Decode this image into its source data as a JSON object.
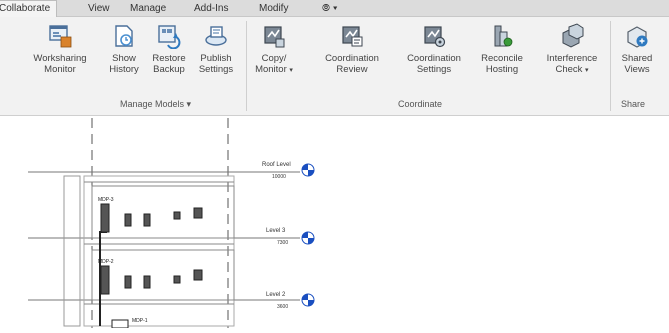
{
  "tabs": [
    "Collaborate",
    "View",
    "Manage",
    "Add-Ins",
    "Modify",
    "⦾ ▾"
  ],
  "ribbon": {
    "buttons": [
      {
        "line1": "Worksharing",
        "line2": "Monitor",
        "icon": "worksharing-monitor-icon"
      },
      {
        "line1": "Show",
        "line2": "History",
        "icon": "show-history-icon"
      },
      {
        "line1": "Restore",
        "line2": "Backup",
        "icon": "restore-backup-icon"
      },
      {
        "line1": "Publish",
        "line2": "Settings",
        "icon": "publish-settings-icon"
      },
      {
        "line1": "Copy/",
        "line2": "Monitor",
        "icon": "copy-monitor-icon"
      },
      {
        "line1": "Coordination",
        "line2": "Review",
        "icon": "coordination-review-icon"
      },
      {
        "line1": "Coordination",
        "line2": "Settings",
        "icon": "coordination-settings-icon"
      },
      {
        "line1": "Reconcile",
        "line2": "Hosting",
        "icon": "reconcile-hosting-icon"
      },
      {
        "line1": "Interference",
        "line2": "Check",
        "icon": "interference-check-icon"
      },
      {
        "line1": "Shared",
        "line2": "Views",
        "icon": "shared-views-icon"
      }
    ],
    "panels": {
      "manage_models": "Manage Models ▾",
      "coordinate": "Coordinate",
      "share": "Share"
    }
  },
  "drawing": {
    "levels": [
      {
        "name": "Roof Level",
        "elevation": "10000"
      },
      {
        "name": "Level 3",
        "elevation": "7300"
      },
      {
        "name": "Level 2",
        "elevation": "3600"
      }
    ],
    "equipment_tags": [
      "MDP-3",
      "MDP-2",
      "MDP-1"
    ]
  }
}
